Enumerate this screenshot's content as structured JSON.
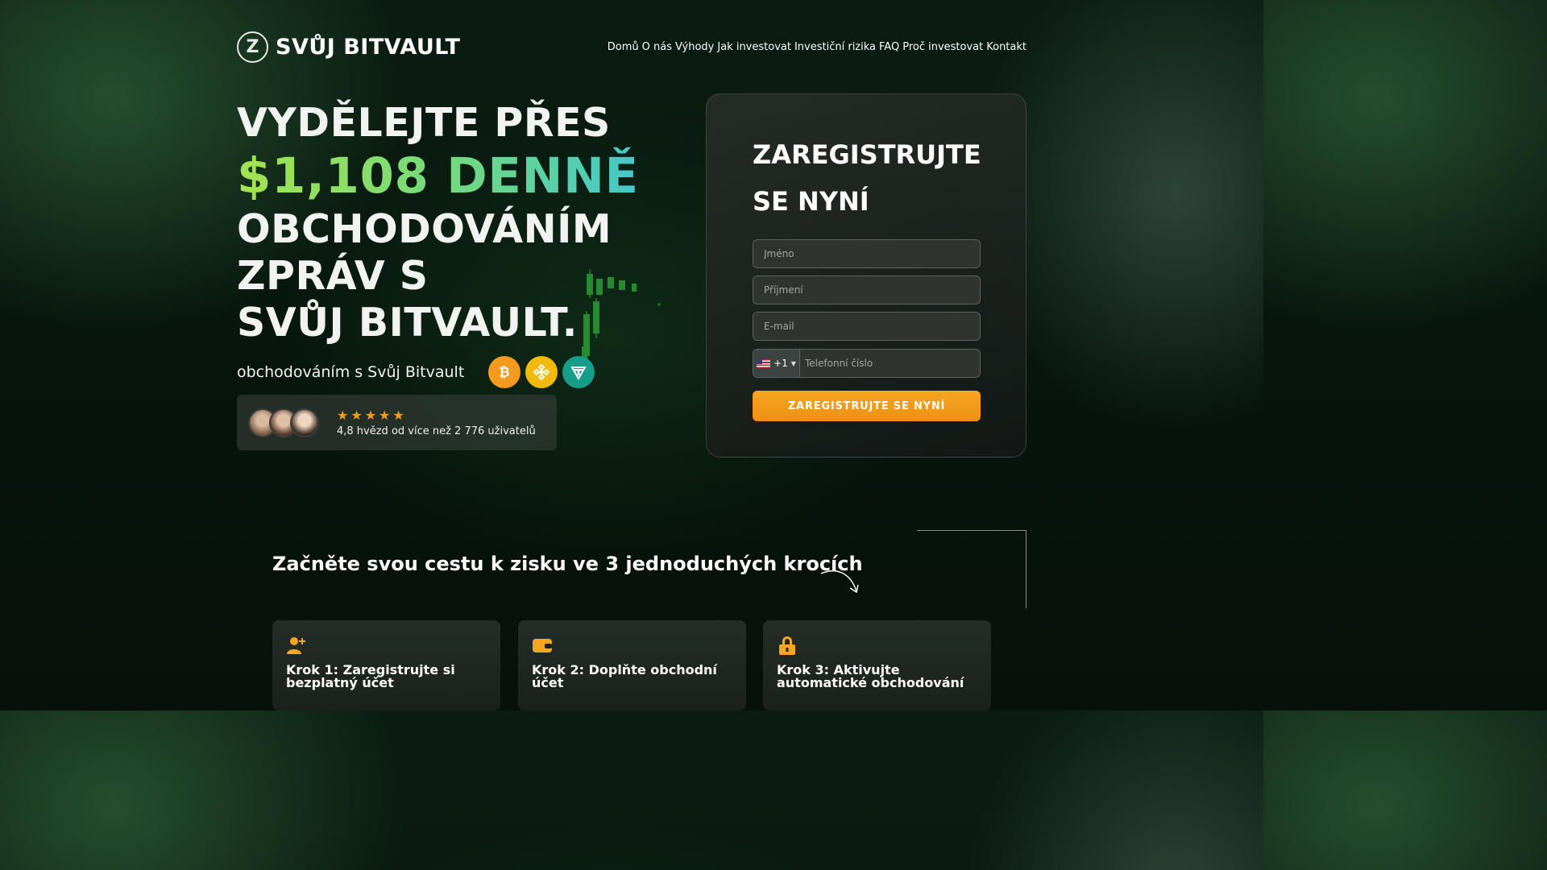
{
  "header": {
    "logo_mark": "Z",
    "logo_text": "SVŮJ BITVAULT",
    "nav": [
      "Domů",
      "O nás",
      "Výhody",
      "Jak investovat",
      "Investiční rizika",
      "FAQ",
      "Proč investovat",
      "Kontakt"
    ]
  },
  "hero": {
    "line1": "VYDĚLEJTE PŘES",
    "line2": "$1,108 DENNĚ",
    "line3": "OBCHODOVÁNÍM",
    "line4": "ZPRÁV S",
    "line5": "SVŮJ BITVAULT.",
    "subtitle": "obchodováním s Svůj Bitvault",
    "coins": [
      "bitcoin-icon",
      "binance-icon",
      "tether-icon"
    ]
  },
  "rating": {
    "stars": 5,
    "text": "4,8 hvězd od více než 2 776 uživatelů"
  },
  "form": {
    "title": "ZAREGISTRUJTE SE NYNÍ",
    "first_name_placeholder": "Jméno",
    "last_name_placeholder": "Příjmení",
    "email_placeholder": "E-mail",
    "phone_code": "+1",
    "phone_placeholder": "Telefonní číslo",
    "submit_label": "ZAREGISTRUJTE SE NYNÍ"
  },
  "steps": {
    "title": "Začněte svou cestu k zisku ve 3 jednoduchých krocích",
    "items": [
      {
        "icon": "add-user-icon",
        "label": "Krok 1: Zaregistrujte si bezplatný účet"
      },
      {
        "icon": "wallet-icon",
        "label": "Krok 2: Doplňte obchodní účet"
      },
      {
        "icon": "lock-icon",
        "label": "Krok 3: Aktivujte automatické obchodování"
      }
    ]
  },
  "colors": {
    "accent_orange": "#f5a623",
    "gradient_green": "#a4e34d",
    "gradient_teal": "#3fc6d2",
    "background": "#07140c"
  }
}
